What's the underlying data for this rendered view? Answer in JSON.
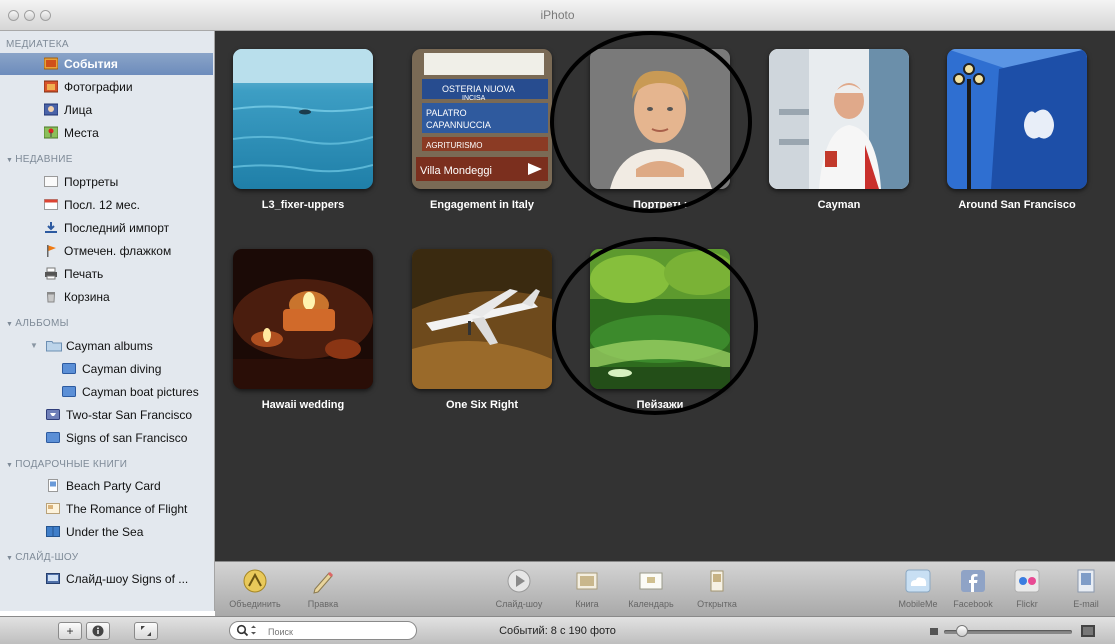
{
  "window": {
    "title": "iPhoto"
  },
  "sidebar": {
    "library_header": "МЕДИАТЕКА",
    "library": [
      {
        "label": "События",
        "icon": "events-icon",
        "selected": true
      },
      {
        "label": "Фотографии",
        "icon": "photos-icon"
      },
      {
        "label": "Лица",
        "icon": "faces-icon"
      },
      {
        "label": "Места",
        "icon": "places-icon"
      }
    ],
    "recent_header": "НЕДАВНИЕ",
    "recent": [
      {
        "label": "Портреты",
        "icon": "album-icon"
      },
      {
        "label": "Посл. 12 мес.",
        "icon": "calendar-icon"
      },
      {
        "label": "Последний импорт",
        "icon": "import-icon"
      },
      {
        "label": "Отмечен. флажком",
        "icon": "flag-icon"
      },
      {
        "label": "Печать",
        "icon": "printer-icon"
      },
      {
        "label": "Корзина",
        "icon": "trash-icon"
      }
    ],
    "albums_header": "АЛЬБОМЫ",
    "albums": [
      {
        "label": "Cayman albums",
        "icon": "folder-icon"
      },
      {
        "label": "Cayman diving",
        "icon": "album-icon"
      },
      {
        "label": "Cayman boat pictures",
        "icon": "album-icon"
      },
      {
        "label": "Two-star San Francisco",
        "icon": "smart-album-icon"
      },
      {
        "label": "Signs of san Francisco",
        "icon": "album-icon"
      }
    ],
    "books_header": "ПОДАРОЧНЫЕ КНИГИ",
    "books": [
      {
        "label": "Beach Party Card",
        "icon": "card-icon"
      },
      {
        "label": "The Romance of Flight",
        "icon": "calendar-project-icon"
      },
      {
        "label": "Under the Sea",
        "icon": "book-icon"
      }
    ],
    "slideshows_header": "СЛАЙД-ШОУ",
    "slideshows": [
      {
        "label": "Слайд-шоу Signs of ...",
        "icon": "slideshow-icon"
      }
    ]
  },
  "events": [
    {
      "label": "L3_fixer-uppers"
    },
    {
      "label": "Engagement in Italy"
    },
    {
      "label": "Портреты",
      "circled": true
    },
    {
      "label": "Cayman"
    },
    {
      "label": "Around San Francisco"
    },
    {
      "label": "Hawaii wedding"
    },
    {
      "label": "One Six Right"
    },
    {
      "label": "Пейзажи",
      "circled": true
    }
  ],
  "sign_texts": [
    "OSTERIA NUOVA",
    "INCISA",
    "PALATRO",
    "CAPANNUCCIA",
    "AGRITURISMO",
    "Villa Mondeggi"
  ],
  "toolbar": {
    "merge": "Объединить",
    "edit": "Правка",
    "slideshow": "Слайд-шоу",
    "book": "Книга",
    "calendar": "Календарь",
    "card": "Открытка",
    "mobileme": "MobileMe",
    "facebook": "Facebook",
    "flickr": "Flickr",
    "email": "E-mail"
  },
  "statusbar": {
    "search_placeholder": "Поиск",
    "status_text": "Событий: 8 с 190 фото"
  }
}
